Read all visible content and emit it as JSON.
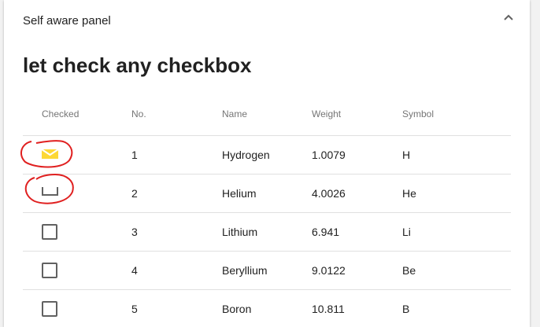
{
  "panel": {
    "title": "Self aware panel",
    "expanded": true,
    "toggle_icon": "chevron-up-icon"
  },
  "heading": "let check any checkbox",
  "table": {
    "columns": [
      "Checked",
      "No.",
      "Name",
      "Weight",
      "Symbol"
    ],
    "rows": [
      {
        "checked": true,
        "no": "1",
        "name": "Hydrogen",
        "weight": "1.0079",
        "symbol": "H"
      },
      {
        "checked": false,
        "no": "2",
        "name": "Helium",
        "weight": "4.0026",
        "symbol": "He"
      },
      {
        "checked": false,
        "no": "3",
        "name": "Lithium",
        "weight": "6.941",
        "symbol": "Li"
      },
      {
        "checked": false,
        "no": "4",
        "name": "Beryllium",
        "weight": "9.0122",
        "symbol": "Be"
      },
      {
        "checked": false,
        "no": "5",
        "name": "Boron",
        "weight": "10.811",
        "symbol": "B"
      }
    ]
  },
  "colors": {
    "checked_fill": "#fdd835",
    "annotation": "#e02020",
    "checkbox_border": "#616161"
  }
}
